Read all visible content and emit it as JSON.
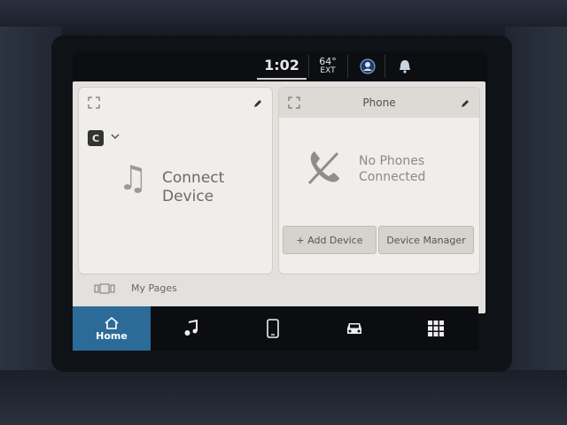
{
  "status": {
    "time": "1:02",
    "temperature": "64°",
    "temperature_label": "EXT"
  },
  "media_panel": {
    "source_logo": "C",
    "title": "Connect Device"
  },
  "phone_panel": {
    "header": "Phone",
    "message": "No Phones Connected",
    "add_device_label": "+ Add Device",
    "device_manager_label": "Device Manager"
  },
  "footer": {
    "my_pages_label": "My Pages"
  },
  "nav": {
    "home_label": "Home",
    "items": [
      "music-icon",
      "phone-device-icon",
      "vehicle-icon",
      "apps-grid-icon"
    ]
  },
  "colors": {
    "home_active": "#2c6b97",
    "screen_bg": "#e3e1dd"
  }
}
